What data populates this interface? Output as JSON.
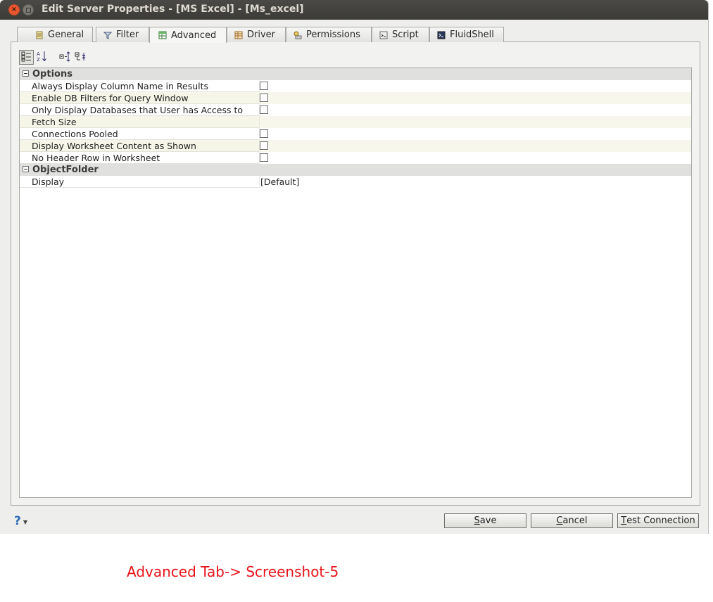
{
  "window": {
    "title": "Edit Server Properties - [MS Excel] - [Ms_excel]"
  },
  "tabs": [
    {
      "label": "General",
      "icon": "general-icon"
    },
    {
      "label": "Filter",
      "icon": "filter-icon"
    },
    {
      "label": "Advanced",
      "icon": "advanced-icon",
      "active": true
    },
    {
      "label": "Driver",
      "icon": "driver-icon"
    },
    {
      "label": "Permissions",
      "icon": "permissions-icon"
    },
    {
      "label": "Script",
      "icon": "script-icon"
    },
    {
      "label": "FluidShell",
      "icon": "fluidshell-icon"
    }
  ],
  "toolbar": {
    "buttons": [
      "categorized-view-icon",
      "sort-alphabetical-icon",
      "expand-all-icon",
      "collapse-all-icon"
    ]
  },
  "properties": {
    "categories": [
      {
        "name": "Options",
        "rows": [
          {
            "name": "Always Display Column Name in Results",
            "type": "checkbox",
            "checked": false
          },
          {
            "name": "Enable DB Filters for Query Window",
            "type": "checkbox",
            "checked": false
          },
          {
            "name": "Only Display Databases that User has Access to",
            "type": "checkbox",
            "checked": false
          },
          {
            "name": "Fetch Size",
            "type": "text",
            "value": ""
          },
          {
            "name": "Connections Pooled",
            "type": "checkbox",
            "checked": false
          },
          {
            "name": "Display Worksheet Content as Shown",
            "type": "checkbox",
            "checked": false
          },
          {
            "name": "No Header Row in Worksheet",
            "type": "checkbox",
            "checked": false
          }
        ]
      },
      {
        "name": "ObjectFolder",
        "rows": [
          {
            "name": "Display",
            "type": "text",
            "value": "[Default]"
          }
        ]
      }
    ]
  },
  "footer": {
    "help_label": "?",
    "save_label": "Save",
    "save_mnemonic": "S",
    "save_rest": "ave",
    "cancel_mnemonic": "C",
    "cancel_rest": "ancel",
    "test_mnemonic": "T",
    "test_rest": "est Connection"
  },
  "caption": "Advanced Tab-> Screenshot-5",
  "colors": {
    "caption": "#e8131a",
    "titlebar": "#3c3b37",
    "close_button": "#e9572f"
  }
}
